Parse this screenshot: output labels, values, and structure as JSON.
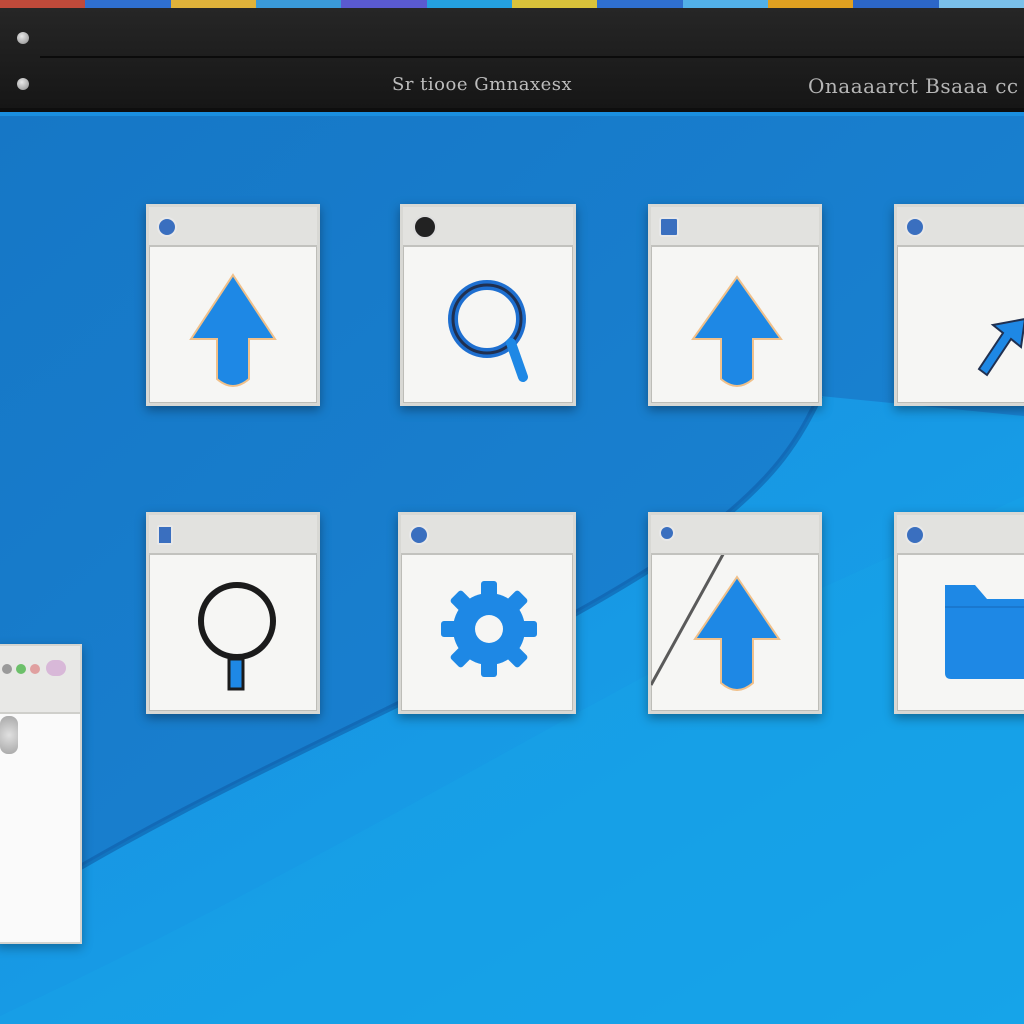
{
  "window": {
    "title_left": "Sr tiooe Gmnaxesx",
    "title_right": "Onaaaarct Bsaaa cc"
  },
  "colors": {
    "desktop": "#1a8fe0",
    "accent": "#1e88e5",
    "tile_bg": "#f6f6f4",
    "titlebar": "#1c1c1c"
  },
  "tiles": [
    {
      "name": "upload-arrow-tile",
      "icon": "arrow-up-icon"
    },
    {
      "name": "search-tile",
      "icon": "magnifier-icon"
    },
    {
      "name": "upload-arrow-tile-2",
      "icon": "arrow-up-icon"
    },
    {
      "name": "cursor-tile",
      "icon": "cursor-arrow-icon"
    },
    {
      "name": "search-tile-2",
      "icon": "magnifier-icon"
    },
    {
      "name": "settings-tile",
      "icon": "gear-icon"
    },
    {
      "name": "upload-arrow-tile-3",
      "icon": "arrow-up-icon"
    },
    {
      "name": "folder-tile",
      "icon": "folder-icon"
    }
  ]
}
